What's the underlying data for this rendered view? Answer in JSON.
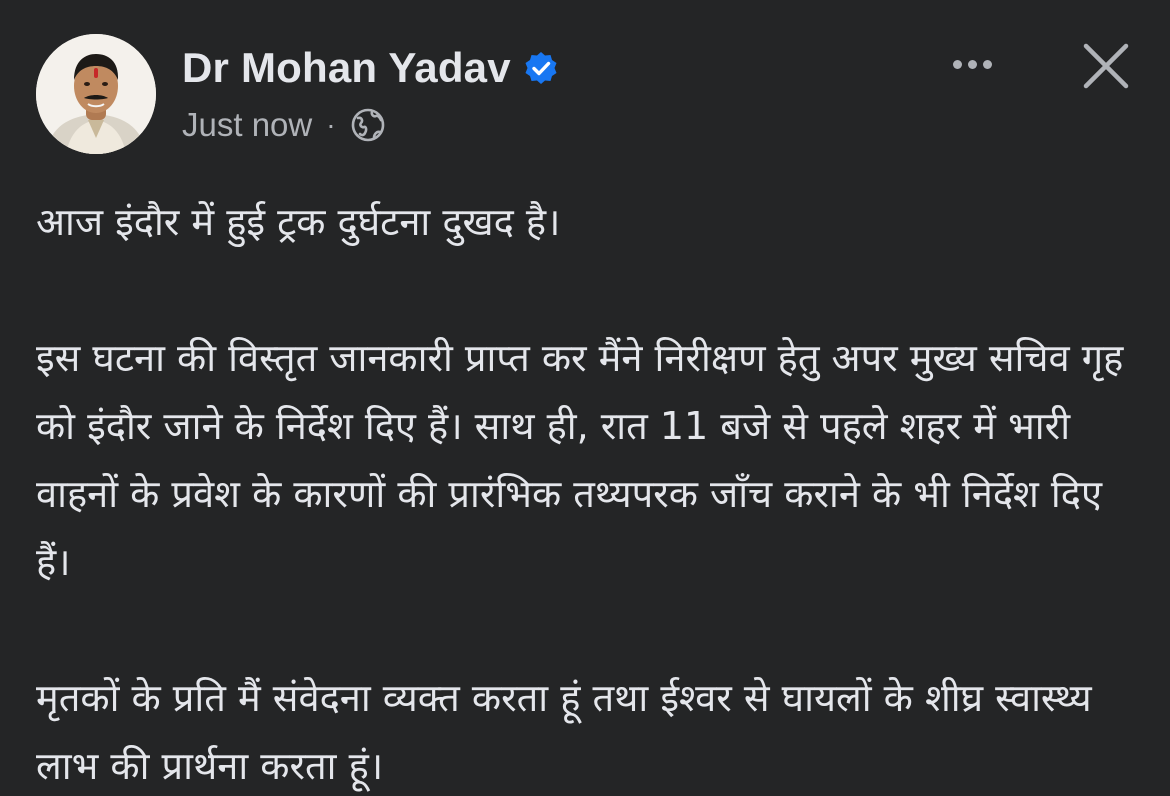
{
  "author": {
    "name": "Dr Mohan Yadav",
    "verified": true,
    "avatar_icon": "profile-photo"
  },
  "meta": {
    "timestamp": "Just now",
    "separator": "·",
    "audience_icon": "globe-icon"
  },
  "actions": {
    "more_icon": "more-horizontal-icon",
    "close_icon": "close-icon"
  },
  "post": {
    "paragraphs": [
      "आज इंदौर में हुई ट्रक दुर्घटना दुखद है।",
      "इस घटना की विस्तृत जानकारी प्राप्त कर मैंने निरीक्षण हेतु अपर मुख्य सचिव गृह को इंदौर जाने के निर्देश दिए हैं। साथ ही, रात 11 बजे से पहले शहर में भारी वाहनों के प्रवेश के कारणों की प्रारंभिक तथ्यपरक जाँच कराने के भी निर्देश दिए हैं।",
      "मृतकों के प्रति मैं संवेदना व्यक्त करता हूं तथा ईश्वर से घायलों के शीघ्र स्वास्थ्य लाभ की प्रार्थना करता हूं।"
    ]
  },
  "colors": {
    "background": "#242526",
    "primary_text": "#e4e6eb",
    "secondary_text": "#b0b3b8",
    "verified_badge": "#1877f2"
  }
}
